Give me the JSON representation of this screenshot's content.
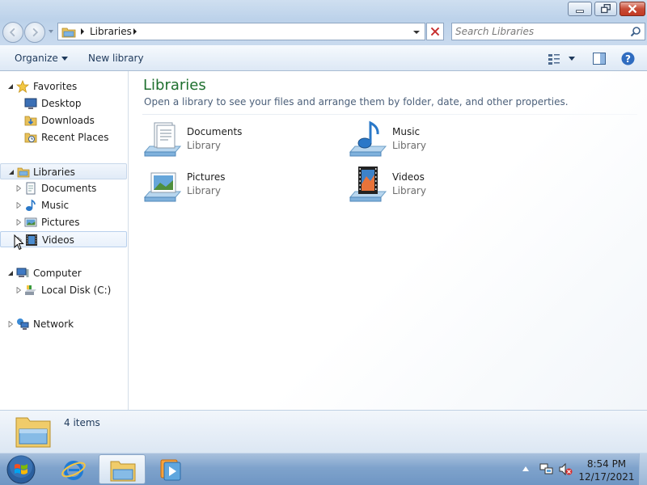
{
  "window": {
    "buttons": {
      "minimize": "minimize-icon",
      "maximize": "restore-icon",
      "close": "close-icon"
    }
  },
  "address_bar": {
    "breadcrumb": "Libraries",
    "icon": "libraries-icon"
  },
  "search": {
    "placeholder": "Search Libraries",
    "icon": "search-icon"
  },
  "toolbar": {
    "organize_label": "Organize",
    "new_library_label": "New library"
  },
  "nav": {
    "favorites": {
      "label": "Favorites",
      "items": [
        "Desktop",
        "Downloads",
        "Recent Places"
      ]
    },
    "libraries": {
      "label": "Libraries",
      "items": [
        "Documents",
        "Music",
        "Pictures",
        "Videos"
      ]
    },
    "computer": {
      "label": "Computer",
      "items": [
        "Local Disk (C:)"
      ]
    },
    "network": {
      "label": "Network"
    }
  },
  "content": {
    "title": "Libraries",
    "subtitle": "Open a library to see your files and arrange them by folder, date, and other properties.",
    "libraries": [
      {
        "name": "Documents",
        "type": "Library",
        "icon": "documents-library-icon"
      },
      {
        "name": "Music",
        "type": "Library",
        "icon": "music-library-icon"
      },
      {
        "name": "Pictures",
        "type": "Library",
        "icon": "pictures-library-icon"
      },
      {
        "name": "Videos",
        "type": "Library",
        "icon": "videos-library-icon"
      }
    ]
  },
  "details": {
    "count": "4 items"
  },
  "taskbar": {
    "apps": [
      "internet-explorer",
      "windows-explorer",
      "windows-media-player"
    ],
    "clock": {
      "time": "8:54 PM",
      "date": "12/17/2021"
    }
  },
  "colors": {
    "title_green": "#1e6f2e",
    "selection": "#e1ebf7",
    "taskbar": "#7fa3cc"
  }
}
